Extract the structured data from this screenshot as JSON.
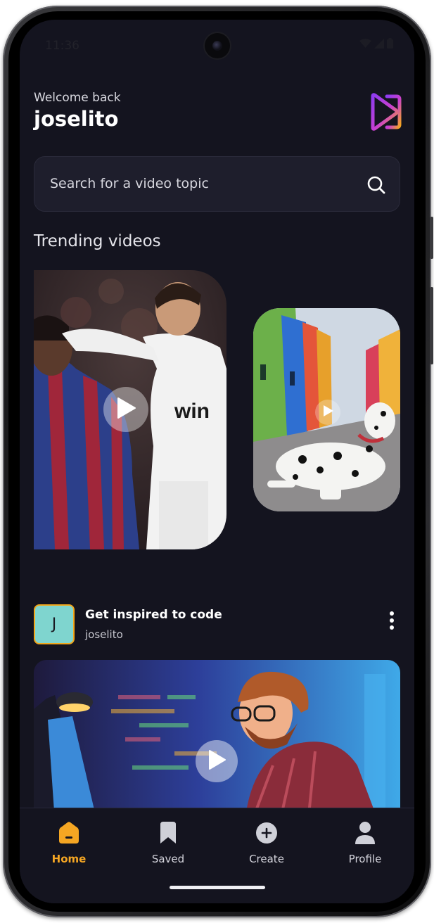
{
  "status_bar": {
    "time": "11:36"
  },
  "header": {
    "welcome": "Welcome back",
    "username": "joselito"
  },
  "search": {
    "placeholder": "Search for a video topic"
  },
  "trending": {
    "title": "Trending videos",
    "videos": [
      {
        "subject": "soccer-players"
      },
      {
        "subject": "dalmatian-dog"
      }
    ]
  },
  "post": {
    "avatar_initial": "J",
    "title": "Get inspired to code",
    "author": "joselito"
  },
  "bottom_nav": {
    "items": [
      {
        "label": "Home",
        "icon": "home-icon",
        "active": true
      },
      {
        "label": "Saved",
        "icon": "bookmark-icon",
        "active": false
      },
      {
        "label": "Create",
        "icon": "plus-circle-icon",
        "active": false
      },
      {
        "label": "Profile",
        "icon": "user-icon",
        "active": false
      }
    ]
  },
  "colors": {
    "background": "#14141f",
    "accent": "#f5a623",
    "logo_purple": "#9b3df5",
    "avatar_bg": "#7fd5cf"
  }
}
